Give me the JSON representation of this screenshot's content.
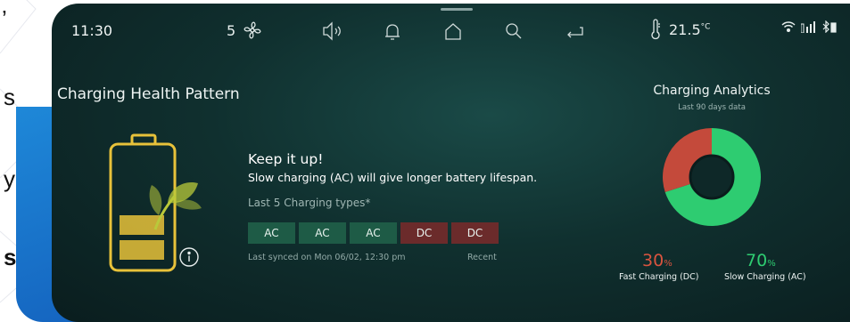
{
  "side_text": [
    "’",
    "s",
    "y",
    "s"
  ],
  "status_bar": {
    "time": "11:30",
    "fan_speed": "5",
    "temperature": "21.5",
    "temperature_unit": "°C",
    "nav_icons": [
      "volume-icon",
      "bell-icon",
      "home-icon",
      "search-icon",
      "back-icon"
    ]
  },
  "page": {
    "title": "Charging Health Pattern"
  },
  "message": {
    "headline": "Keep it up!",
    "body": "Slow charging (AC) will give longer battery lifespan.",
    "sub_label": "Last 5 Charging types*"
  },
  "charging_types": [
    "AC",
    "AC",
    "AC",
    "DC",
    "DC"
  ],
  "sync": {
    "text": "Last synced on Mon 06/02, 12:30 pm",
    "recent_label": "Recent"
  },
  "analytics": {
    "title": "Charging Analytics",
    "subtitle": "Last 90 days data",
    "fast": {
      "value": "30",
      "unit": "%",
      "label": "Fast Charging (DC)",
      "fraction": 0.3,
      "color": "#c44a3b"
    },
    "slow": {
      "value": "70",
      "unit": "%",
      "label": "Slow Charging (AC)",
      "fraction": 0.7,
      "color": "#2ecc71"
    }
  },
  "colors": {
    "ac_chip": "#1e5b46",
    "dc_chip": "#6b2b2b",
    "battery_gold": "#e8c23a",
    "leaf_green": "#b9c93a"
  }
}
